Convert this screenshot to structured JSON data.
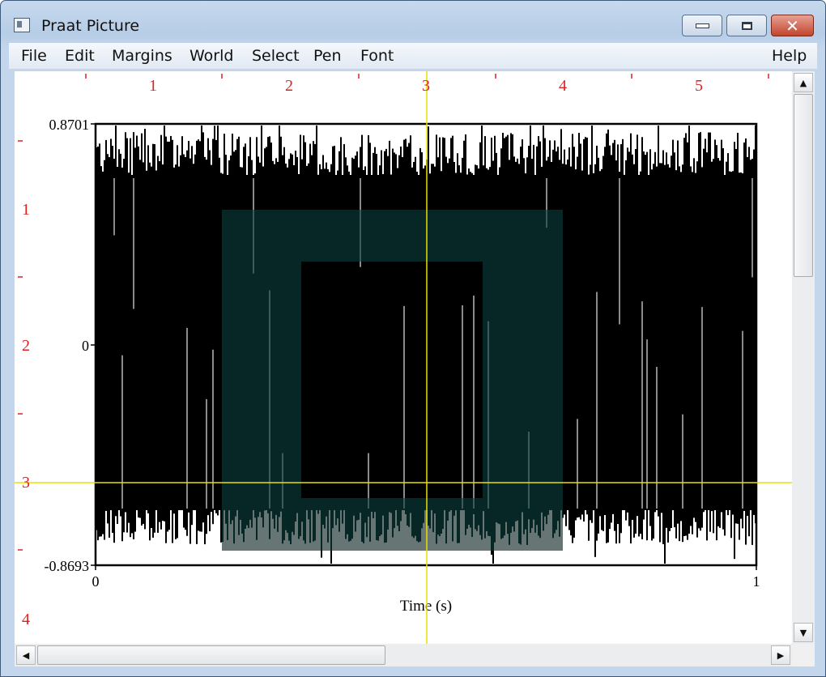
{
  "window": {
    "title": "Praat Picture",
    "controls": {
      "minimize": "minimize",
      "maximize": "maximize",
      "close": "✕"
    }
  },
  "menu": {
    "items": [
      "File",
      "Edit",
      "Margins",
      "World",
      "Select",
      "Pen",
      "Font"
    ],
    "help": "Help"
  },
  "ruler": {
    "top_labels": [
      "1",
      "2",
      "3",
      "4",
      "5"
    ],
    "left_labels": [
      "1",
      "2",
      "3",
      "4"
    ],
    "color": "#e02020"
  },
  "plot": {
    "y_max_label": "0.8701",
    "y_zero_label": "0",
    "y_min_label": "-0.8693",
    "x_min_label": "0",
    "x_max_label": "1",
    "x_axis_title": "Time (s)",
    "waveform_color": "#000000",
    "selection_color": "#ffcccc",
    "crosshair_color": "#e8e000"
  },
  "chart_data": {
    "type": "line",
    "xlabel": "Time (s)",
    "ylabel": "",
    "xlim": [
      0,
      1
    ],
    "ylim": [
      -0.8693,
      0.8701
    ],
    "x_ticks": [
      0,
      1
    ],
    "y_ticks": [
      -0.8693,
      0,
      0.8701
    ]
  }
}
